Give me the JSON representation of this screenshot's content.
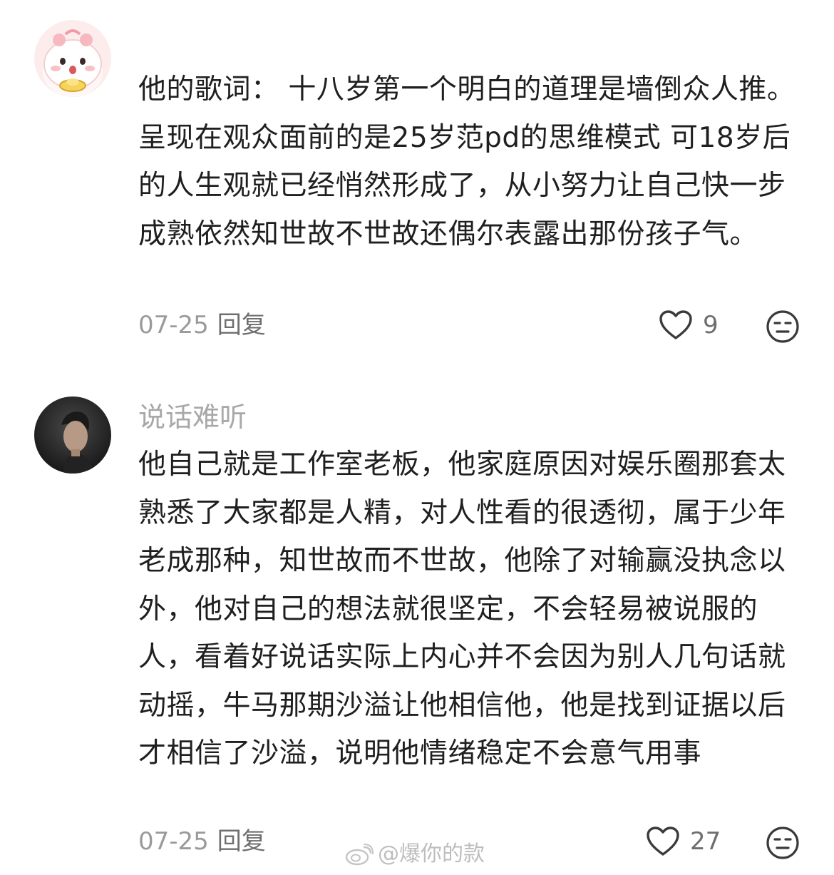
{
  "comments": [
    {
      "avatar": "pink-cartoon-avatar",
      "username": "",
      "text": "他的歌词： 十八岁第一个明白的道理是墙倒众人推。呈现在观众面前的是25岁范pd的思维模式 可18岁后的人生观就已经悄然形成了，从小努力让自己快一步成熟依然知世故不世故还偶尔表露出那份孩子气。",
      "date": "07-25",
      "reply_label": "回复",
      "likes": "9"
    },
    {
      "avatar": "dark-photo-avatar",
      "username": "说话难听",
      "text": "他自己就是工作室老板，他家庭原因对娱乐圈那套太熟悉了大家都是人精，对人性看的很透彻，属于少年老成那种，知世故而不世故，他除了对输赢没执念以外，他对自己的想法就很坚定，不会轻易被说服的人，看着好说话实际上内心并不会因为别人几句话就动摇，牛马那期沙溢让他相信他，他是找到证据以后才相信了沙溢，说明他情绪稳定不会意气用事",
      "date": "07-25",
      "reply_label": "回复",
      "likes": "27"
    }
  ],
  "watermark": "@爆你的款",
  "icons": {
    "like": "heart-outline-icon",
    "emoji": "neutral-face-icon",
    "watermark": "weibo-logo-icon"
  },
  "colors": {
    "text": "#1f1f1f",
    "muted": "#9a9a9a",
    "icon": "#3a3a3a"
  }
}
